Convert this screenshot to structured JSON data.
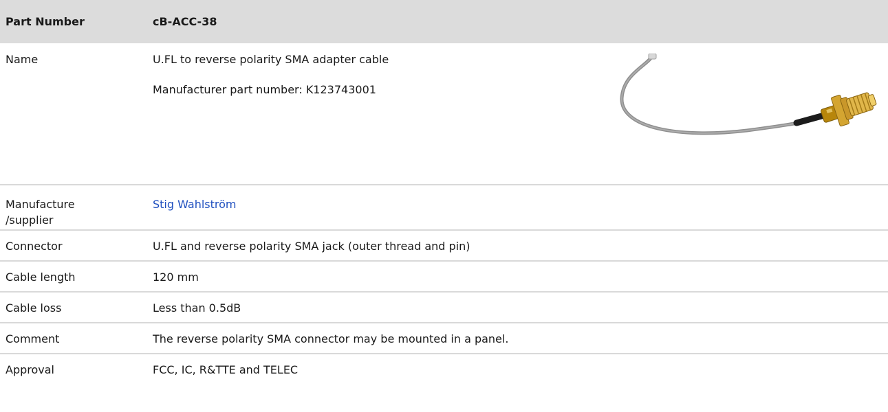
{
  "header": {
    "label": "Part Number",
    "value": "cB-ACC-38"
  },
  "name_row": {
    "label": "Name",
    "value": "U.FL to reverse polarity SMA adapter cable",
    "manufacturer_part_number": "Manufacturer part number: K123743001",
    "image": {
      "description": "cable-with-sma-connector-image"
    }
  },
  "rows": [
    {
      "label_line1": "Manufacture",
      "label_line2": "/supplier",
      "value": "Stig Wahlström",
      "is_link": true
    },
    {
      "label": "Connector",
      "value": "U.FL and reverse polarity SMA jack (outer thread and pin)"
    },
    {
      "label": "Cable length",
      "value": "120 mm"
    },
    {
      "label": "Cable loss",
      "value": "Less than 0.5dB"
    },
    {
      "label": "Comment",
      "value": "The reverse polarity SMA connector may be mounted in a panel."
    },
    {
      "label": "Approval",
      "value": "FCC, IC, R&TTE and TELEC"
    }
  ],
  "colors": {
    "header_background": "#dcdcdc",
    "divider": "#d9d9d9",
    "link": "#1f4fbf"
  }
}
